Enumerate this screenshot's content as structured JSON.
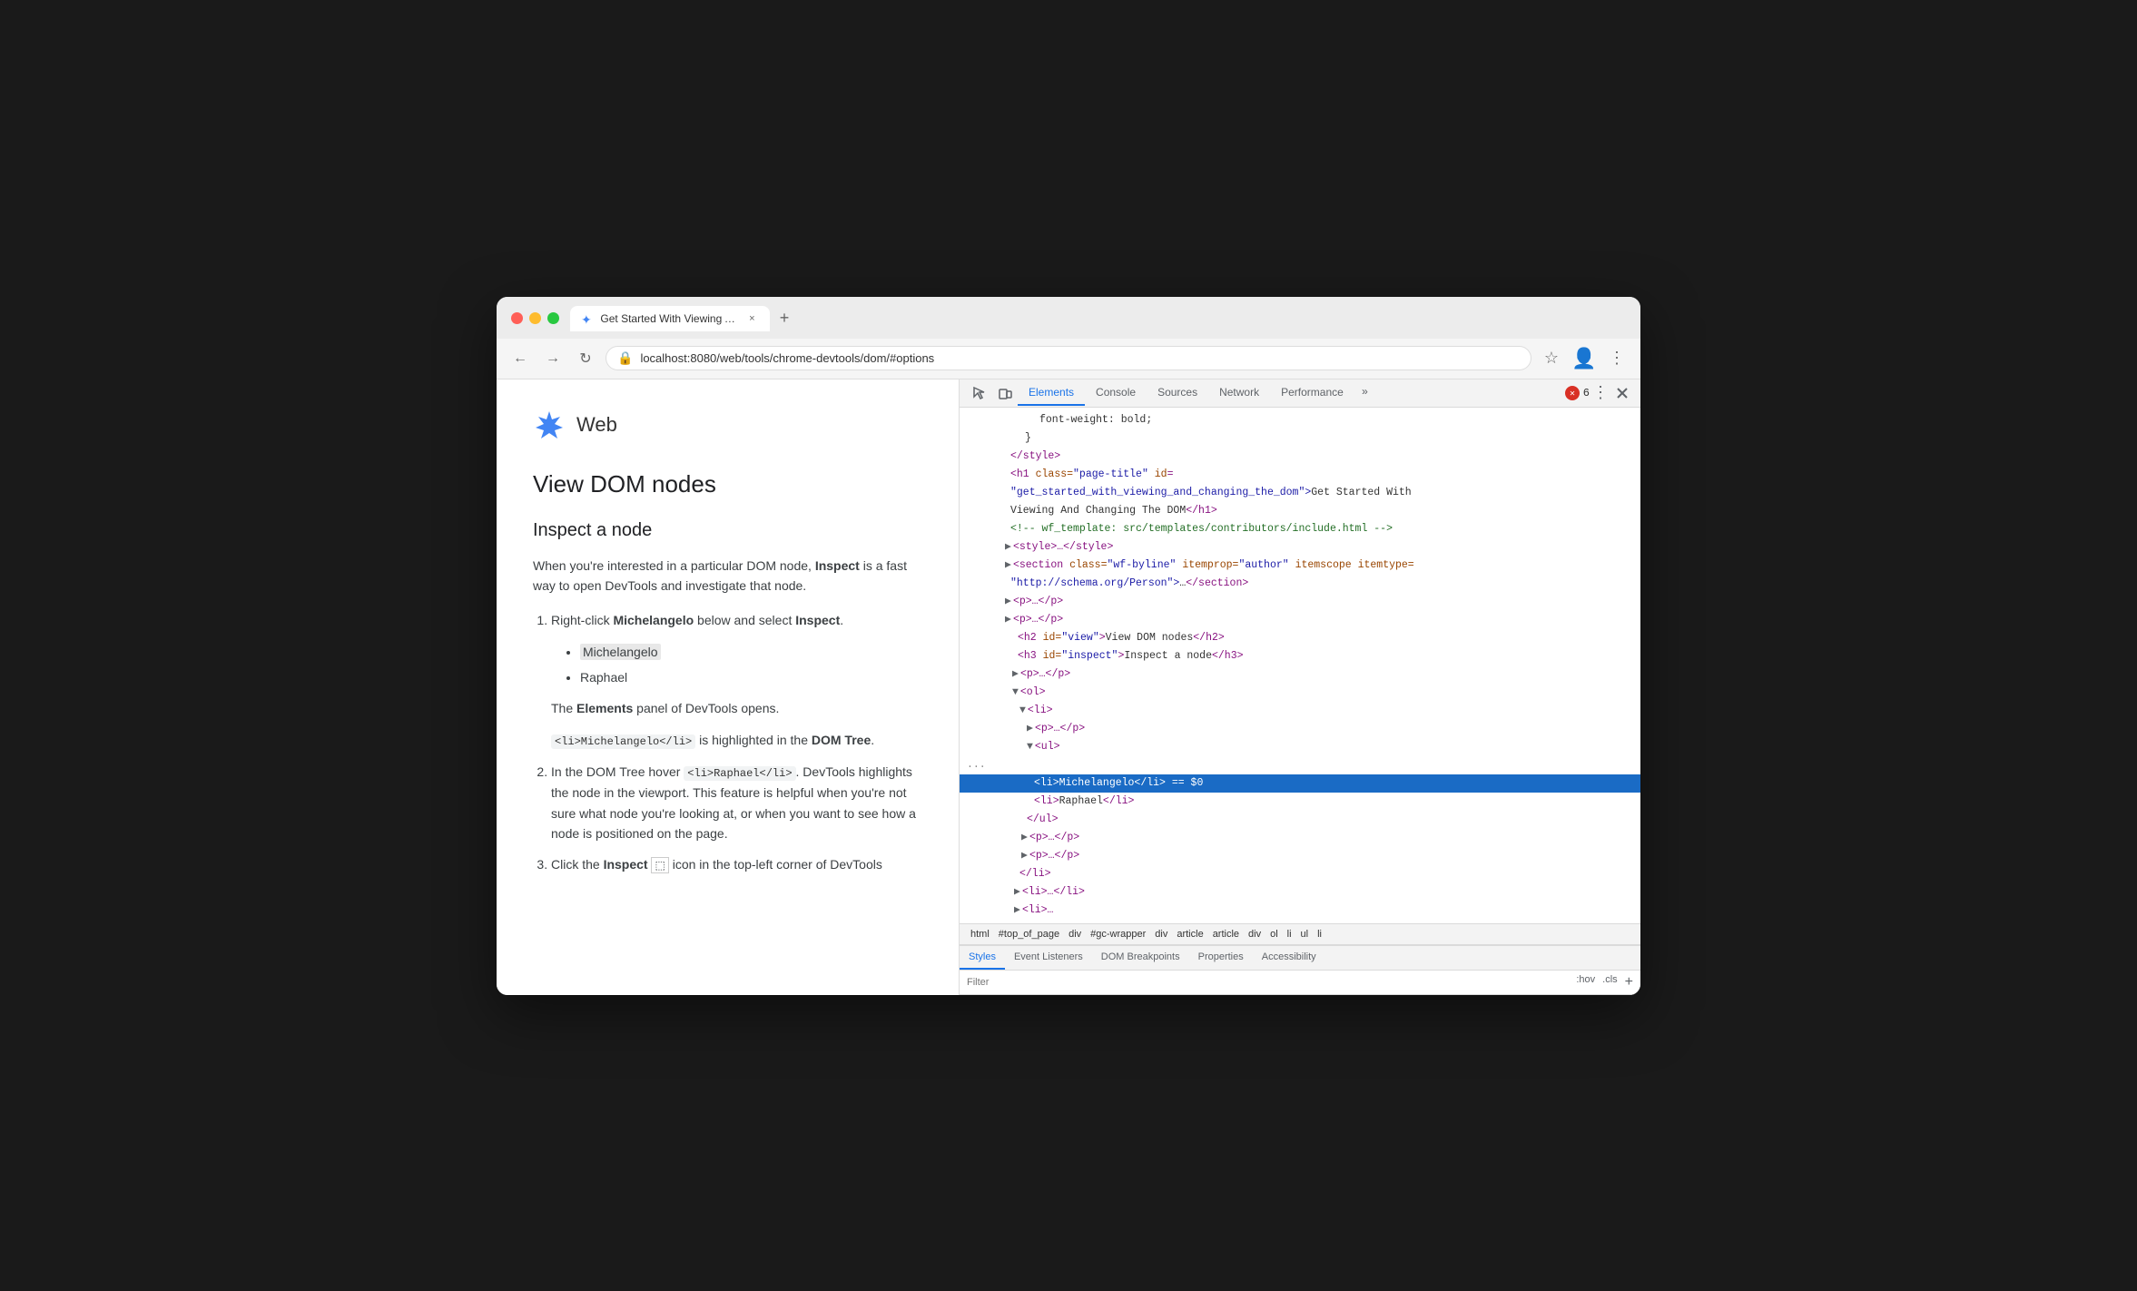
{
  "browser": {
    "tab_title": "Get Started With Viewing And",
    "url": "localhost:8080/web/tools/chrome-devtools/dom/#options",
    "favicon": "✦"
  },
  "site": {
    "logo_symbol": "✦",
    "name": "Web"
  },
  "page": {
    "main_heading": "View DOM nodes",
    "section_heading": "Inspect a node",
    "intro_text": "When you're interested in a particular DOM node, Inspect is a fast way to open DevTools and investigate that node.",
    "step1_text": "Right-click Michelangelo below and select Inspect.",
    "list_item_1": "Michelangelo",
    "list_item_2": "Raphael",
    "note_elements": "The Elements panel of DevTools opens.",
    "note_code": "<li>Michelangelo</li>",
    "note_highlighted": " is highlighted in the ",
    "note_dom_tree": "DOM Tree",
    "step2_text": "In the DOM Tree hover ",
    "step2_code": "<li>Raphael</li>",
    "step2_rest": ". DevTools highlights the node in the viewport. This feature is helpful when you're not sure what node you're looking at, or when you want to see how a node is positioned on the page.",
    "step3_text": "Click the Inspect ",
    "step3_rest": " icon in the top-left corner of DevTools"
  },
  "devtools": {
    "tabs": [
      "Elements",
      "Console",
      "Sources",
      "Network",
      "Performance"
    ],
    "tab_more": "»",
    "error_count": "6",
    "active_tab": "Elements",
    "filter_placeholder": "Filter",
    "filter_hov": ":hov",
    "filter_cls": ".cls"
  },
  "dom_tree": {
    "lines": [
      {
        "indent": 10,
        "content": "font-weight: bold;",
        "type": "text"
      },
      {
        "indent": 8,
        "content": "}",
        "type": "text"
      },
      {
        "indent": 6,
        "content": "</style>",
        "type": "close-tag",
        "tag": "style"
      },
      {
        "indent": 6,
        "content": "<h1 class=\"page-title\" id=",
        "type": "open-tag"
      },
      {
        "indent": 6,
        "content": "\"get_started_with_viewing_and_changing_the_dom\">Get Started With",
        "type": "attr-val"
      },
      {
        "indent": 6,
        "content": "Viewing And Changing The DOM</h1>",
        "type": "text"
      },
      {
        "indent": 6,
        "content": "<!-- wf_template: src/templates/contributors/include.html -->",
        "type": "comment"
      },
      {
        "indent": 6,
        "content": "<style>…</style>",
        "type": "collapsed"
      },
      {
        "indent": 6,
        "content": "<section class=\"wf-byline\" itemprop=\"author\" itemscope itemtype=",
        "type": "open-tag"
      },
      {
        "indent": 6,
        "content": "\"http://schema.org/Person\">…</section>",
        "type": "attr-val"
      },
      {
        "indent": 6,
        "content": "<p>…</p>",
        "type": "collapsed"
      },
      {
        "indent": 6,
        "content": "<p>…</p>",
        "type": "collapsed"
      },
      {
        "indent": 8,
        "content": "<h2 id=\"view\">View DOM nodes</h2>",
        "type": "element"
      },
      {
        "indent": 8,
        "content": "<h3 id=\"inspect\">Inspect a node</h3>",
        "type": "element"
      },
      {
        "indent": 8,
        "content": "<p>…</p>",
        "type": "collapsed"
      },
      {
        "indent": 8,
        "content": "<ol>",
        "type": "open"
      },
      {
        "indent": 10,
        "content": "<li>",
        "type": "open"
      },
      {
        "indent": 12,
        "content": "<p>…</p>",
        "type": "collapsed"
      },
      {
        "indent": 12,
        "content": "<ul>",
        "type": "open"
      },
      {
        "indent": 0,
        "content": "...",
        "type": "ellipsis"
      },
      {
        "indent": 16,
        "content": "<li>Michelangelo</li> == $0",
        "type": "selected"
      },
      {
        "indent": 16,
        "content": "<li>Raphael</li>",
        "type": "element"
      },
      {
        "indent": 12,
        "content": "</ul>",
        "type": "close"
      },
      {
        "indent": 12,
        "content": "<p>…</p>",
        "type": "collapsed"
      },
      {
        "indent": 12,
        "content": "<p>…</p>",
        "type": "collapsed"
      },
      {
        "indent": 10,
        "content": "</li>",
        "type": "close"
      },
      {
        "indent": 10,
        "content": "<li>…</li>",
        "type": "collapsed"
      },
      {
        "indent": 10,
        "content": "<li>…</li>",
        "type": "collapsed-partial"
      }
    ]
  },
  "breadcrumb": {
    "items": [
      "html",
      "#top_of_page",
      "div",
      "#gc-wrapper",
      "div",
      "article",
      "article",
      "div",
      "ol",
      "li",
      "ul",
      "li"
    ]
  },
  "styles_tabs": [
    "Styles",
    "Event Listeners",
    "DOM Breakpoints",
    "Properties",
    "Accessibility"
  ],
  "icons": {
    "inspect": "⬚",
    "device": "▭",
    "close": "×",
    "menu": "⋮",
    "back": "←",
    "forward": "→",
    "refresh": "↻",
    "star": "☆",
    "account": "○",
    "chrome_menu": "⋮",
    "lock": "🔒",
    "expand": "▶",
    "collapse": "▼"
  }
}
